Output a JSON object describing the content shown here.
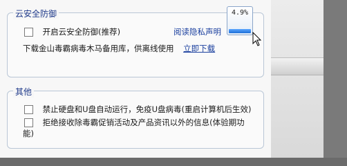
{
  "security_group": {
    "title": "云安全防御",
    "enable_label": "开启云安全防御(推荐)",
    "privacy_link": "阅读隐私声明",
    "download_text": "下载金山毒霸病毒木马备用库，供离线使用",
    "download_link": "立即下载",
    "enable_checked": false
  },
  "cpu_meter": {
    "label": "4.9%",
    "percent": 4.9,
    "fill_color": "#2f86f0"
  },
  "other_group": {
    "title": "其他",
    "option1_label": "禁止硬盘和U盘自动运行，免疫U盘病毒(重启计算机后生效)",
    "option1_checked": false,
    "option2_line1": "拒绝接收除毒霸促销活动及产品资讯以外的信息(体验期功",
    "option2_line2": "能)",
    "option2_checked": false
  },
  "colors": {
    "group_title": "#1f3a8a",
    "link": "#1a3f9e",
    "group_border": "#b9c6d6"
  },
  "icons": {
    "cursor": "arrow-cursor-icon",
    "checkbox": "checkbox-unchecked-icon"
  }
}
